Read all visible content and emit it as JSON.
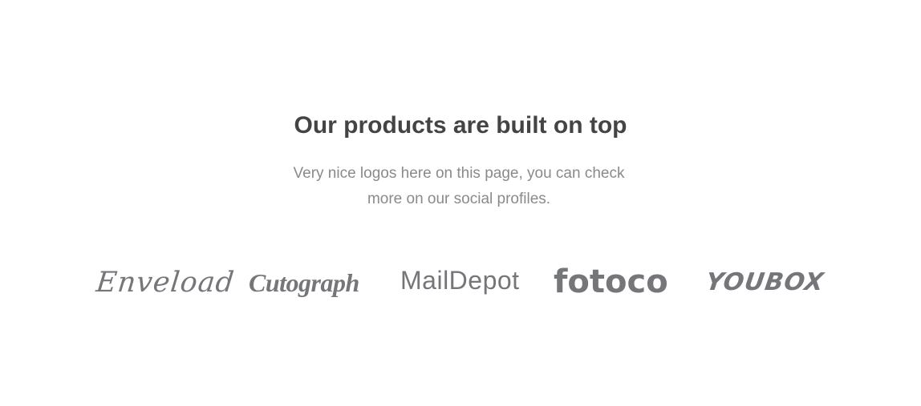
{
  "section": {
    "title": "Our products are built on top",
    "description_line1": "Very nice logos here on this page, you can check",
    "description_line2": "more on our social profiles."
  },
  "logos": [
    {
      "name": "Enveload"
    },
    {
      "name": "Cutograph"
    },
    {
      "name": "MailDepot"
    },
    {
      "name": "fotoco"
    },
    {
      "name": "YOUBOX"
    }
  ],
  "colors": {
    "title": "#444444",
    "description": "#8a8a8a",
    "logo": "#75767a",
    "background": "#ffffff"
  }
}
